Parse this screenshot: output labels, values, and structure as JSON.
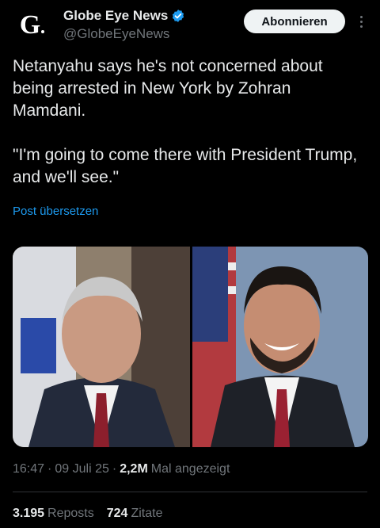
{
  "account": {
    "display_name": "Globe Eye News",
    "handle": "@GlobeEyeNews",
    "avatar_letter": "G",
    "verified_icon": "verified-badge-icon",
    "verified_color": "#1d9bf0"
  },
  "actions": {
    "subscribe_label": "Abonnieren",
    "more_icon": "more-options-icon"
  },
  "tweet": {
    "text": "Netanyahu says he's not concerned about being arrested in New York by Zohran Mamdani.\n\n\"I'm going to come there with President Trump, and we'll see.\"",
    "translate_label": "Post übersetzen"
  },
  "meta": {
    "time": "16:47",
    "date": "09 Juli 25",
    "views_count": "2,2M",
    "views_label": "Mal angezeigt"
  },
  "stats": {
    "reposts_count": "3.195",
    "reposts_label": "Reposts",
    "quotes_count": "724",
    "quotes_label": "Zitate"
  },
  "colors": {
    "background": "#000000",
    "text": "#e7e9ea",
    "muted": "#71767b",
    "link": "#1d9bf0"
  }
}
